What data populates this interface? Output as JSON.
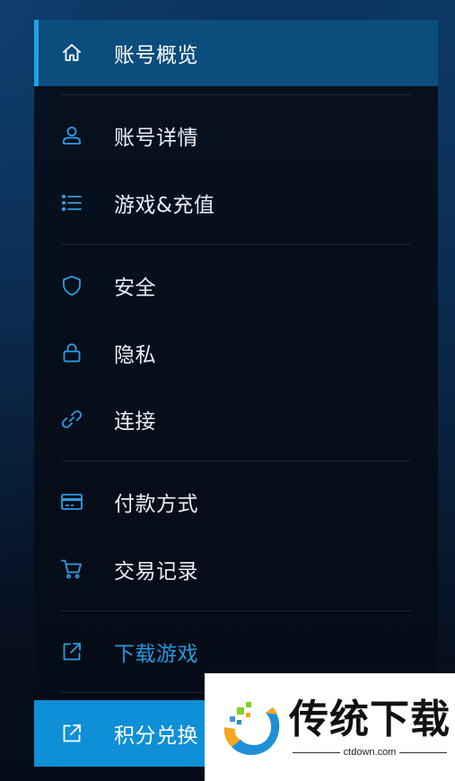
{
  "colors": {
    "accent": "#1fa3e6",
    "active_background": "#0b4d7c",
    "highlight_background": "#0f8fd6",
    "icon": "#2b9fe3",
    "link_text": "#1f9be0",
    "text": "#e8eef5",
    "panel_background": "#07111f"
  },
  "menu": {
    "items": [
      {
        "label": "账号概览",
        "icon": "home-icon"
      },
      {
        "label": "账号详情",
        "icon": "user-icon"
      },
      {
        "label": "游戏&充值",
        "icon": "list-icon"
      },
      {
        "label": "安全",
        "icon": "shield-icon"
      },
      {
        "label": "隐私",
        "icon": "lock-icon"
      },
      {
        "label": "连接",
        "icon": "link-icon"
      },
      {
        "label": "付款方式",
        "icon": "credit-card-icon"
      },
      {
        "label": "交易记录",
        "icon": "cart-icon"
      },
      {
        "label": "下载游戏",
        "icon": "external-link-icon"
      },
      {
        "label": "积分兑换",
        "icon": "external-link-icon"
      }
    ]
  },
  "watermark": {
    "title": "传统下载",
    "subtitle": "ctdown.com"
  }
}
